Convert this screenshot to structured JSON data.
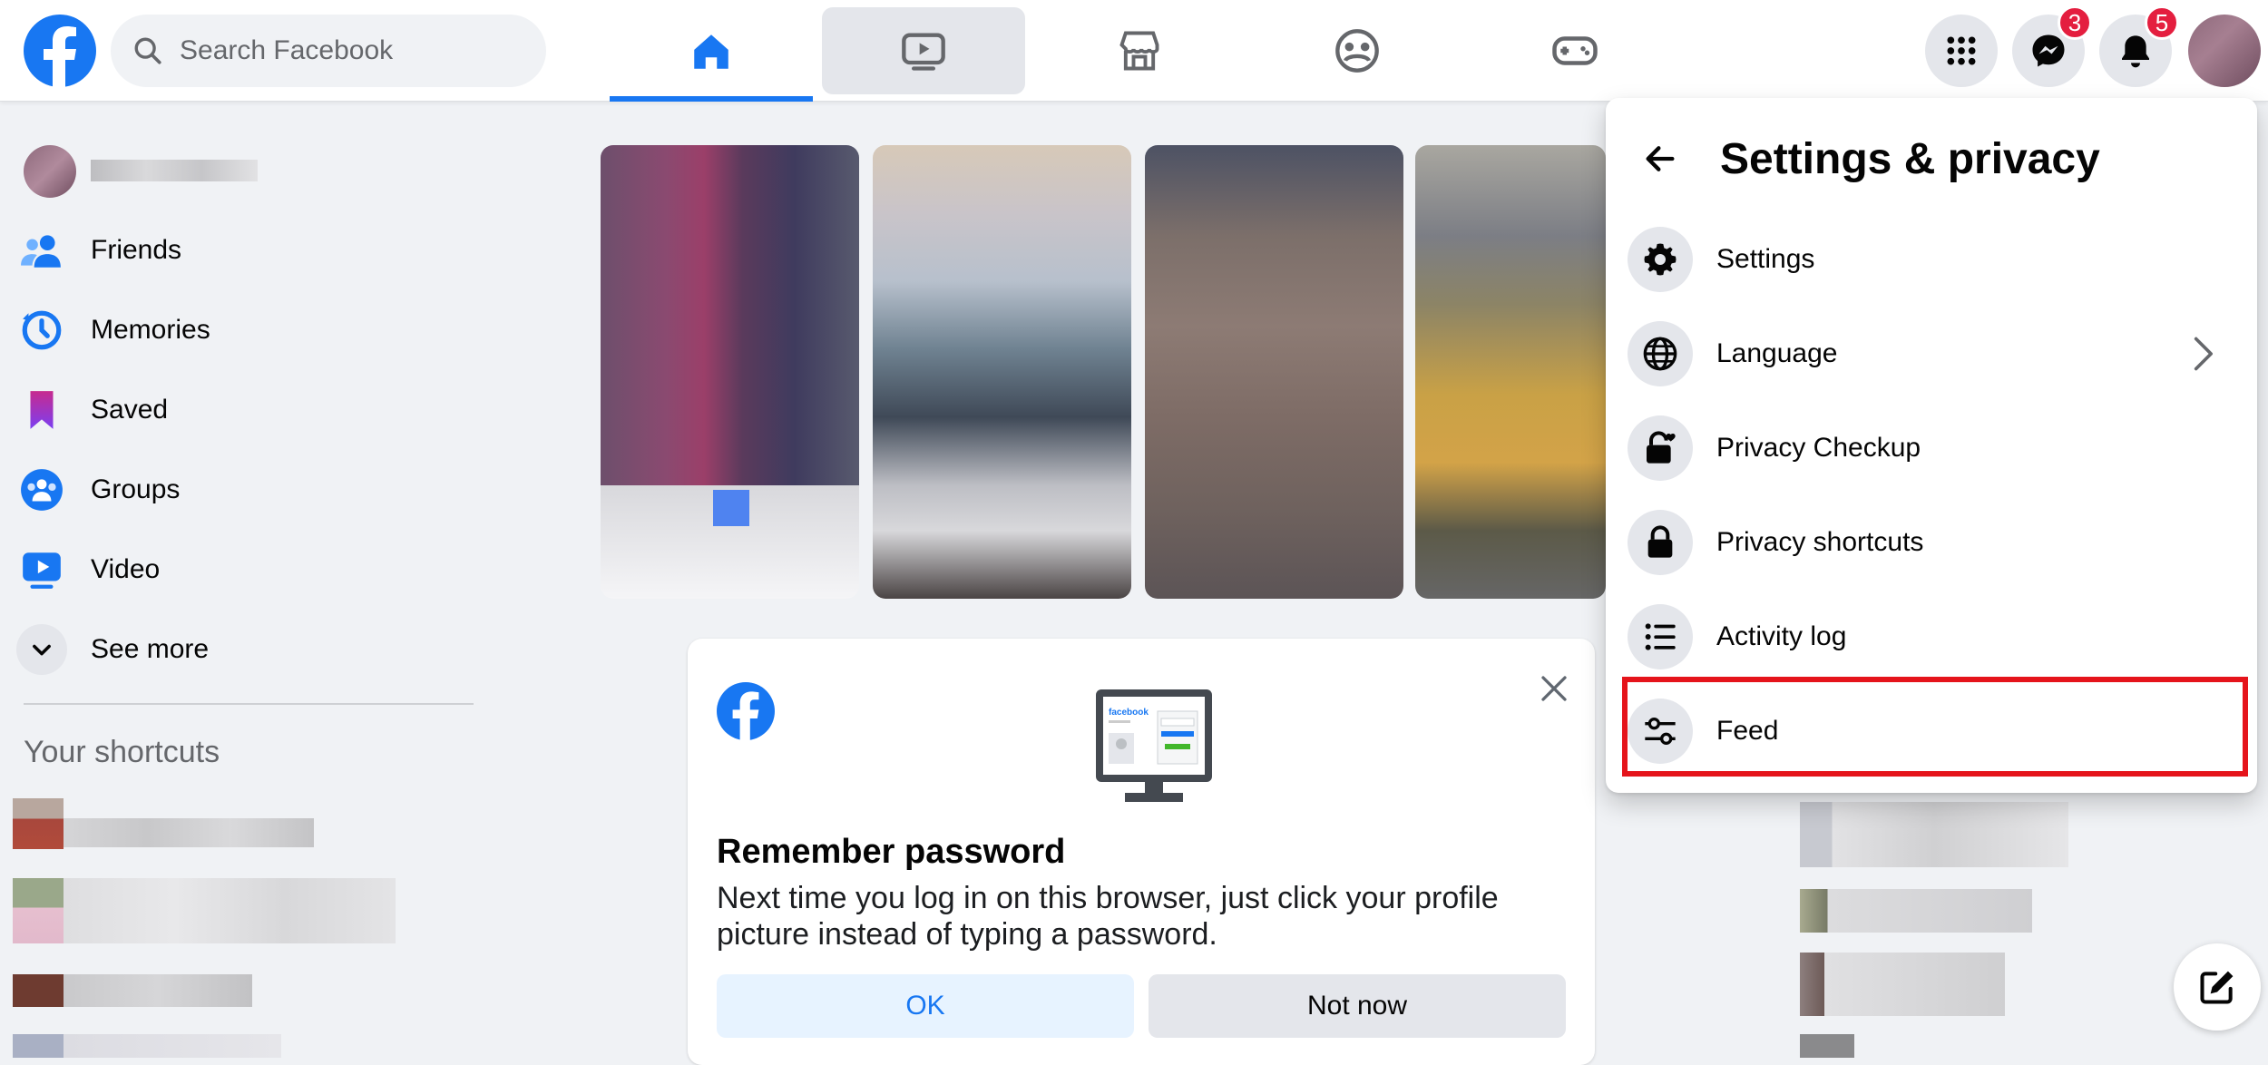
{
  "header": {
    "search_placeholder": "Search Facebook",
    "messenger_badge": "3",
    "notifications_badge": "5"
  },
  "sidebar": {
    "items": [
      {
        "label": "Friends",
        "icon": "friends-icon"
      },
      {
        "label": "Memories",
        "icon": "memories-icon"
      },
      {
        "label": "Saved",
        "icon": "saved-icon"
      },
      {
        "label": "Groups",
        "icon": "groups-icon"
      },
      {
        "label": "Video",
        "icon": "video-icon"
      },
      {
        "label": "See more",
        "icon": "chevron-down-icon"
      }
    ],
    "shortcuts_heading": "Your shortcuts"
  },
  "password_card": {
    "title": "Remember password",
    "description": "Next time you log in on this browser, just click your profile picture instead of typing a password.",
    "ok_label": "OK",
    "not_now_label": "Not now",
    "illustration_logo": "facebook"
  },
  "settings_menu": {
    "title": "Settings & privacy",
    "items": [
      {
        "label": "Settings",
        "icon": "gear-icon"
      },
      {
        "label": "Language",
        "icon": "globe-icon"
      },
      {
        "label": "Privacy Checkup",
        "icon": "lock-heart-icon"
      },
      {
        "label": "Privacy shortcuts",
        "icon": "lock-icon"
      },
      {
        "label": "Activity log",
        "icon": "list-icon"
      },
      {
        "label": "Feed",
        "icon": "sliders-icon"
      }
    ]
  },
  "colors": {
    "brand": "#1877f2",
    "highlight": "#e5141b",
    "badge": "#e41e3f"
  }
}
